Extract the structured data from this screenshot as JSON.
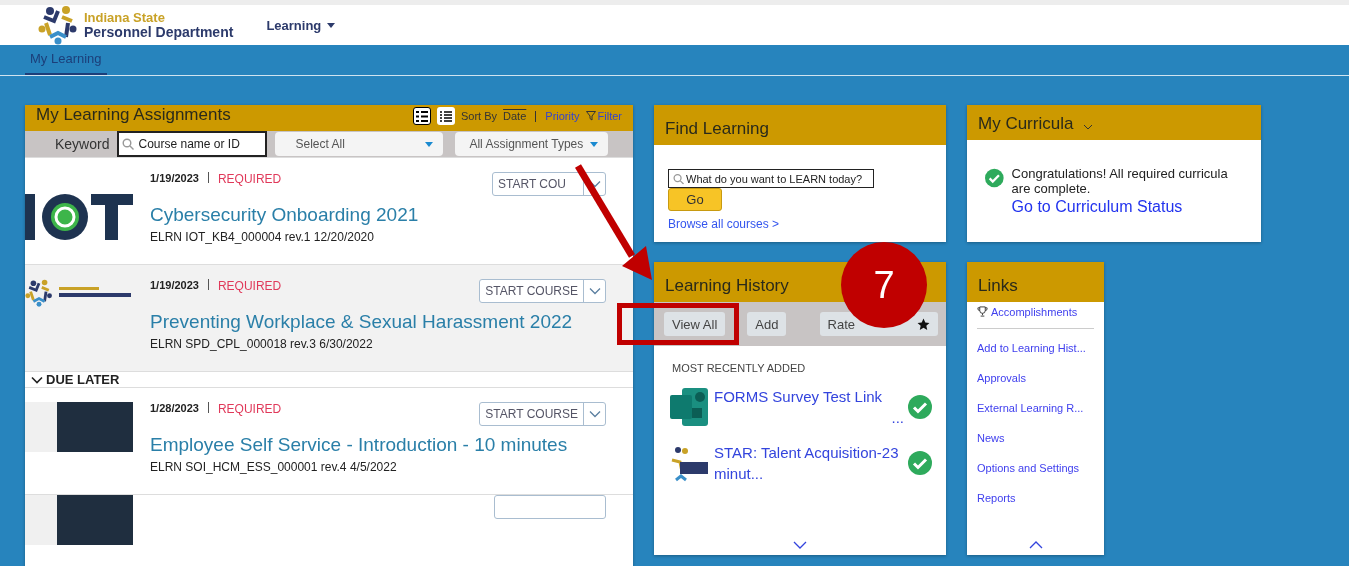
{
  "header": {
    "logo_line1": "Indiana State",
    "logo_line2": "Personnel Department",
    "menu": "Learning"
  },
  "tabs": [
    {
      "label": "My Learning",
      "selected": true
    }
  ],
  "assignments": {
    "title": "My Learning Assignments",
    "sort_by": "Sort By",
    "sort_options": [
      {
        "label": "Date",
        "selected": true
      },
      {
        "label": "Priority",
        "selected": false
      }
    ],
    "filter": "Filter",
    "keyword_label": "Keyword",
    "keyword_placeholder": "Course name or ID",
    "select_1": "Select All",
    "select_2": "All Assignment Types",
    "items": [
      {
        "kind": "course",
        "date": "1/19/2023",
        "tag": "REQUIRED",
        "title": "Cybersecurity Onboarding 2021",
        "code": "ELRN IOT_KB4_000004 rev.1 12/20/2020",
        "button": "START COU",
        "highlighted": false
      },
      {
        "kind": "course",
        "date": "1/19/2023",
        "tag": "REQUIRED",
        "title": "Preventing Workplace & Sexual Harassment 2022",
        "code": "ELRN SPD_CPL_000018 rev.3 6/30/2022",
        "button": "START COURSE",
        "highlighted": true
      },
      {
        "kind": "section",
        "label": "DUE LATER",
        "expanded": true
      },
      {
        "kind": "course",
        "date": "1/28/2023",
        "tag": "REQUIRED",
        "title": "Employee Self Service - Introduction - 10 minutes",
        "code": "ELRN SOI_HCM_ESS_000001 rev.4 4/5/2022",
        "button": "START COURSE",
        "highlighted": false
      },
      {
        "kind": "partial"
      }
    ]
  },
  "find_learning": {
    "title": "Find Learning",
    "placeholder": "What do you want to LEARN today?",
    "go": "Go",
    "browse": "Browse all courses >"
  },
  "history": {
    "title": "Learning History",
    "buttons": [
      "View All",
      "Add"
    ],
    "rate": "Rate",
    "section": "MOST RECENTLY ADDED",
    "items": [
      {
        "title": "FORMS Survey Test Link",
        "ellipsis": "...",
        "completed": true
      },
      {
        "title": "STAR: Talent Acquisition-23 minut...",
        "completed": true
      }
    ]
  },
  "curricula": {
    "title": "My Curricula",
    "message": "Congratulations! All required curricula are complete.",
    "link": "Go to Curriculum Status",
    "complete": true
  },
  "links": {
    "title": "Links",
    "items": [
      {
        "kind": "trophy",
        "label": "Accomplishments"
      },
      {
        "kind": "plain",
        "label": "Add to Learning Hist..."
      },
      {
        "kind": "plain",
        "label": "Approvals"
      },
      {
        "kind": "plain",
        "label": "External Learning R..."
      },
      {
        "kind": "plain",
        "label": "News"
      },
      {
        "kind": "plain",
        "label": "Options and Settings"
      },
      {
        "kind": "plain",
        "label": "Reports"
      }
    ]
  },
  "annotation": {
    "number": "7"
  }
}
